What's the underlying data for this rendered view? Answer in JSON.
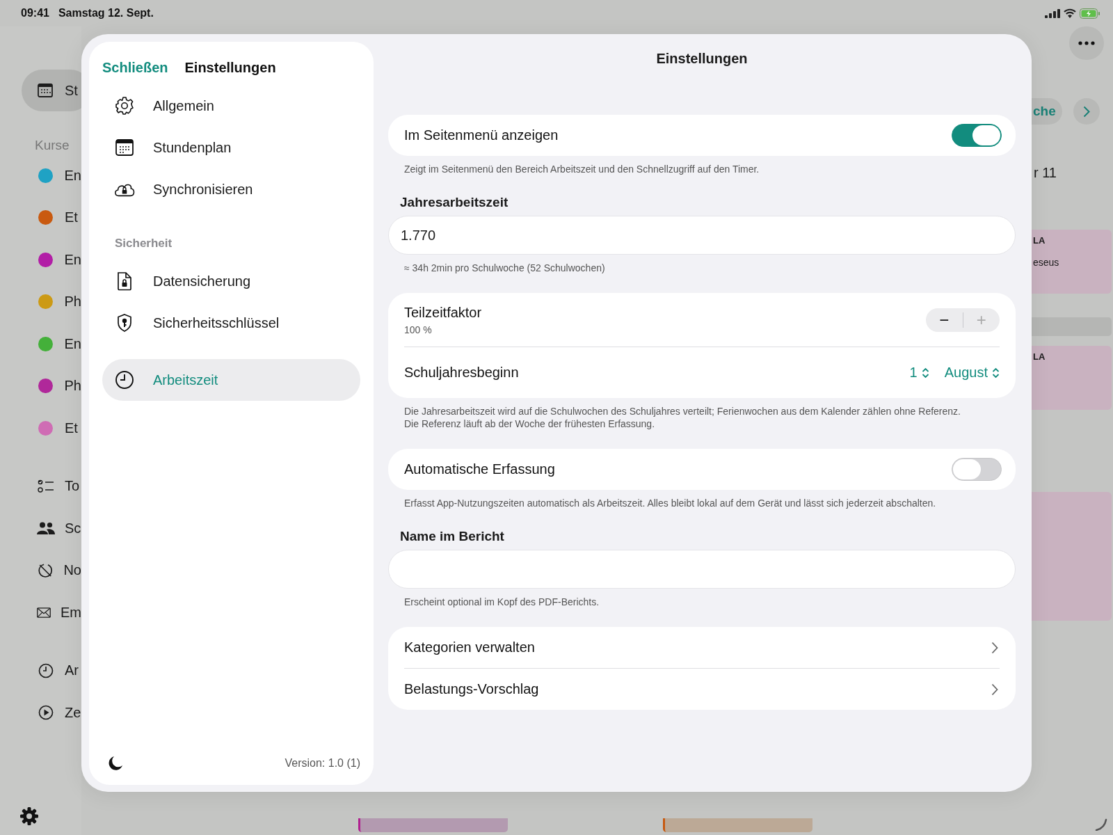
{
  "status_bar": {
    "time": "09:41",
    "date": "Samstag 12. Sept."
  },
  "background": {
    "sidebar": {
      "top_item": {
        "label": "St",
        "selected": true
      },
      "section": "Kurse",
      "courses": [
        {
          "label": "En",
          "color": "#1fa2c4"
        },
        {
          "label": "Et",
          "color": "#c95a10"
        },
        {
          "label": "En",
          "color": "#b21ea6"
        },
        {
          "label": "Ph",
          "color": "#cc9a14"
        },
        {
          "label": "En",
          "color": "#44b03a"
        },
        {
          "label": "Ph",
          "color": "#b0289a"
        },
        {
          "label": "Et",
          "color": "#cf6cb4"
        }
      ],
      "tools": [
        {
          "label": "To"
        },
        {
          "label": "Sc"
        },
        {
          "label": "No"
        },
        {
          "label": "Em"
        }
      ],
      "timers": [
        {
          "label": "Ar"
        },
        {
          "label": "Ze"
        }
      ]
    },
    "calendar": {
      "week_button": "che",
      "day_label": "r 11",
      "events": [
        {
          "title": "LA",
          "subtitle": "eseus"
        },
        {
          "title": "LA"
        }
      ]
    }
  },
  "settings": {
    "close": "Schließen",
    "title": "Einstellungen",
    "sections": [
      {
        "items": [
          {
            "label": "Allgemein",
            "selected": false
          },
          {
            "label": "Stundenplan",
            "selected": false
          },
          {
            "label": "Synchronisieren",
            "selected": false
          }
        ]
      },
      {
        "header": "Sicherheit",
        "items": [
          {
            "label": "Datensicherung",
            "selected": false
          },
          {
            "label": "Sicherheitsschlüssel",
            "selected": false
          }
        ]
      },
      {
        "items": [
          {
            "label": "Arbeitszeit",
            "selected": true
          }
        ]
      }
    ],
    "version": "Version: 1.0 (1)"
  },
  "detail": {
    "title": "Einstellungen",
    "blocks": [
      {
        "kind": "toggle",
        "label": "Im Seitenmenü anzeigen",
        "on": true,
        "footer": "Zeigt im Seitenmenü den Bereich Arbeitszeit und den Schnellzugriff auf den Timer."
      },
      {
        "kind": "field",
        "heading": "Jahresarbeitszeit",
        "value": "1.770",
        "footer": "≈ 34h 2min pro Schulwoche (52 Schulwochen)"
      },
      {
        "kind": "group",
        "rows": [
          {
            "kind": "stepper",
            "label": "Teilzeitfaktor",
            "detail": "100 %",
            "minus": "−",
            "plus": "+",
            "plus_disabled": true
          },
          {
            "kind": "picker",
            "label": "Schuljahresbeginn",
            "pickers": [
              "1",
              "August"
            ]
          }
        ],
        "footer": "Die Jahresarbeitszeit wird auf die Schulwochen des Schuljahres verteilt; Ferienwochen aus dem Kalender zählen ohne Referenz.\nDie Referenz läuft ab der Woche der frühesten Erfassung."
      },
      {
        "kind": "toggle",
        "label": "Automatische Erfassung",
        "on": false,
        "footer": "Erfasst App-Nutzungszeiten automatisch als Arbeitszeit. Alles bleibt lokal auf dem Gerät und lässt sich jederzeit abschalten."
      },
      {
        "kind": "field",
        "heading": "Name im Bericht",
        "footer": "Erscheint optional im Kopf des PDF-Berichts."
      },
      {
        "kind": "group",
        "rows": [
          {
            "kind": "link",
            "label": "Kategorien verwalten"
          },
          {
            "kind": "link",
            "label": "Belastungs-Vorschlag"
          }
        ]
      }
    ]
  }
}
